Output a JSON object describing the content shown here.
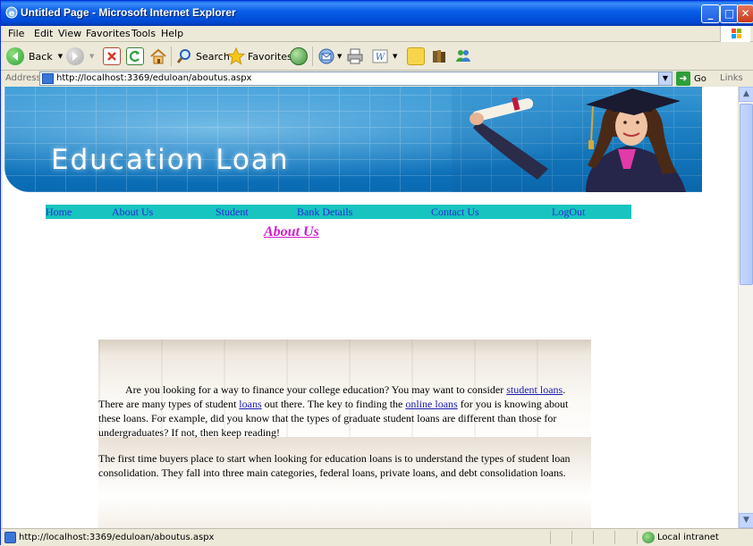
{
  "window": {
    "title": "Untitled Page - Microsoft Internet Explorer",
    "minimize_glyph": "_",
    "maximize_glyph": "□",
    "close_glyph": "✕"
  },
  "menu": [
    "File",
    "Edit",
    "View",
    "Favorites",
    "Tools",
    "Help"
  ],
  "toolbar": {
    "back_label": "Back",
    "search_label": "Search",
    "favorites_label": "Favorites"
  },
  "address": {
    "label": "Address",
    "url": "http://localhost:3369/eduloan/aboutus.aspx",
    "go_label": "Go",
    "links_label": "Links"
  },
  "banner": {
    "title": "Education Loan"
  },
  "nav": {
    "items": [
      "Home",
      "About Us",
      "Student",
      "Bank Details",
      "Contact Us",
      "LogOut"
    ]
  },
  "heading": "About  Us",
  "article": {
    "p1_before": "Are you looking for a way to finance your college education? You may want to consider ",
    "p1_link1": "student loans",
    "p1_mid1": ". There are many types of student ",
    "p1_link2": "loans",
    "p1_mid2": " out there. The key to finding the ",
    "p1_link3": "online loans",
    "p1_after": " for you is knowing about these loans. For example, did you know that the types of graduate student loans are different than those for undergraduates? If not, then keep reading!",
    "p2": "The first time buyers place to start when looking for education loans is to understand the types of student loan consolidation. They fall into three main categories, federal loans, private loans, and debt consolidation loans."
  },
  "status": {
    "text": "http://localhost:3369/eduloan/aboutus.aspx",
    "zone": "Local intranet"
  },
  "colors": {
    "nav_bg": "#18C4C0",
    "heading": "#D21ECE",
    "link": "#1A1AB0",
    "titlebar": "#0A5FE8"
  }
}
